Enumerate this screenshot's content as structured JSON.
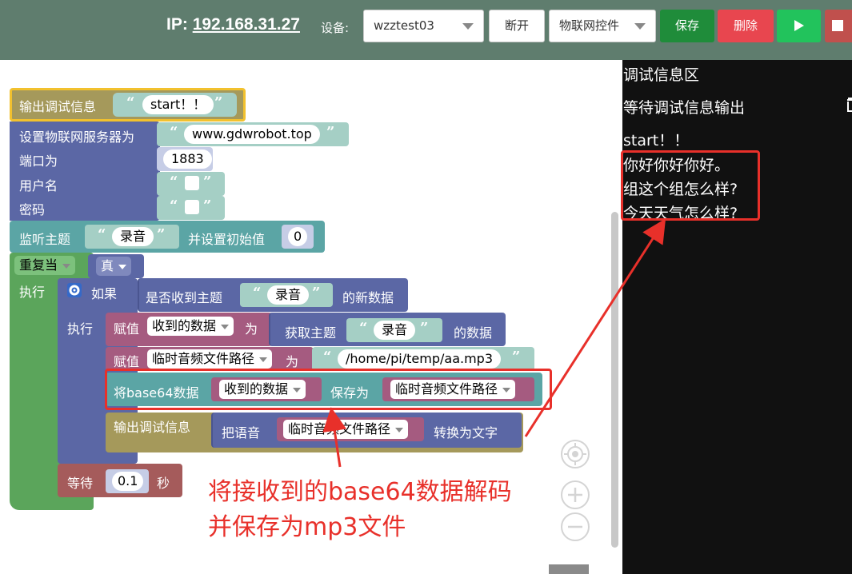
{
  "topbar": {
    "ip_label": "IP:",
    "ip_address": "192.168.31.27",
    "device_label": "设备:",
    "device_value": "wzztest03",
    "disconnect": "断开",
    "iot_value": "物联网控件",
    "save": "保存",
    "delete": "删除",
    "colors": {
      "bar": "#5f7d6e",
      "save": "#1f8c3a",
      "delete": "#e8464f",
      "run": "#22c35c"
    }
  },
  "blocks": {
    "print1": "输出调试信息",
    "print1_str": "start！！",
    "server": "设置物联网服务器为",
    "server_str": "www.gdwrobot.top",
    "port": "端口为",
    "port_val": "1883",
    "user": "用户名",
    "pwd": "密码",
    "subscribe": "监听主题",
    "subscribe_str": "录音",
    "subscribe_init": "并设置初始值",
    "subscribe_init_val": "0",
    "repeat": "重复当",
    "repeat_cond": "真",
    "do": "执行",
    "if": "如果",
    "received": "是否收到主题",
    "received_str": "录音",
    "received_tail": "的新数据",
    "do2": "执行",
    "assign": "赋值",
    "var_received": "收到的数据",
    "as": "为",
    "get_topic": "获取主题",
    "get_topic_str": "录音",
    "get_topic_tail": "的数据",
    "assign2": "赋值",
    "var_path": "临时音频文件路径",
    "as2": "为",
    "path_str": "/home/pi/temp/aa.mp3",
    "b64": "将base64数据",
    "b64_var": "收到的数据",
    "b64_saveas": "保存为",
    "b64_path": "临时音频文件路径",
    "print2": "输出调试信息",
    "speech": "把语音",
    "speech_var": "临时音频文件路径",
    "speech_tail": "转换为文字",
    "wait": "等待",
    "wait_val": "0.1",
    "wait_unit": "秒"
  },
  "panel": {
    "title": "调试信息区",
    "waiting": "等待调试信息输出",
    "lines": [
      "start！！",
      "你好你好你好。",
      "组这个组怎么样?",
      "今天天气怎么样?"
    ]
  },
  "annotation": {
    "line1": "将接收到的base64数据解码",
    "line2": "并保存为mp3文件",
    "color": "#e8302a"
  }
}
